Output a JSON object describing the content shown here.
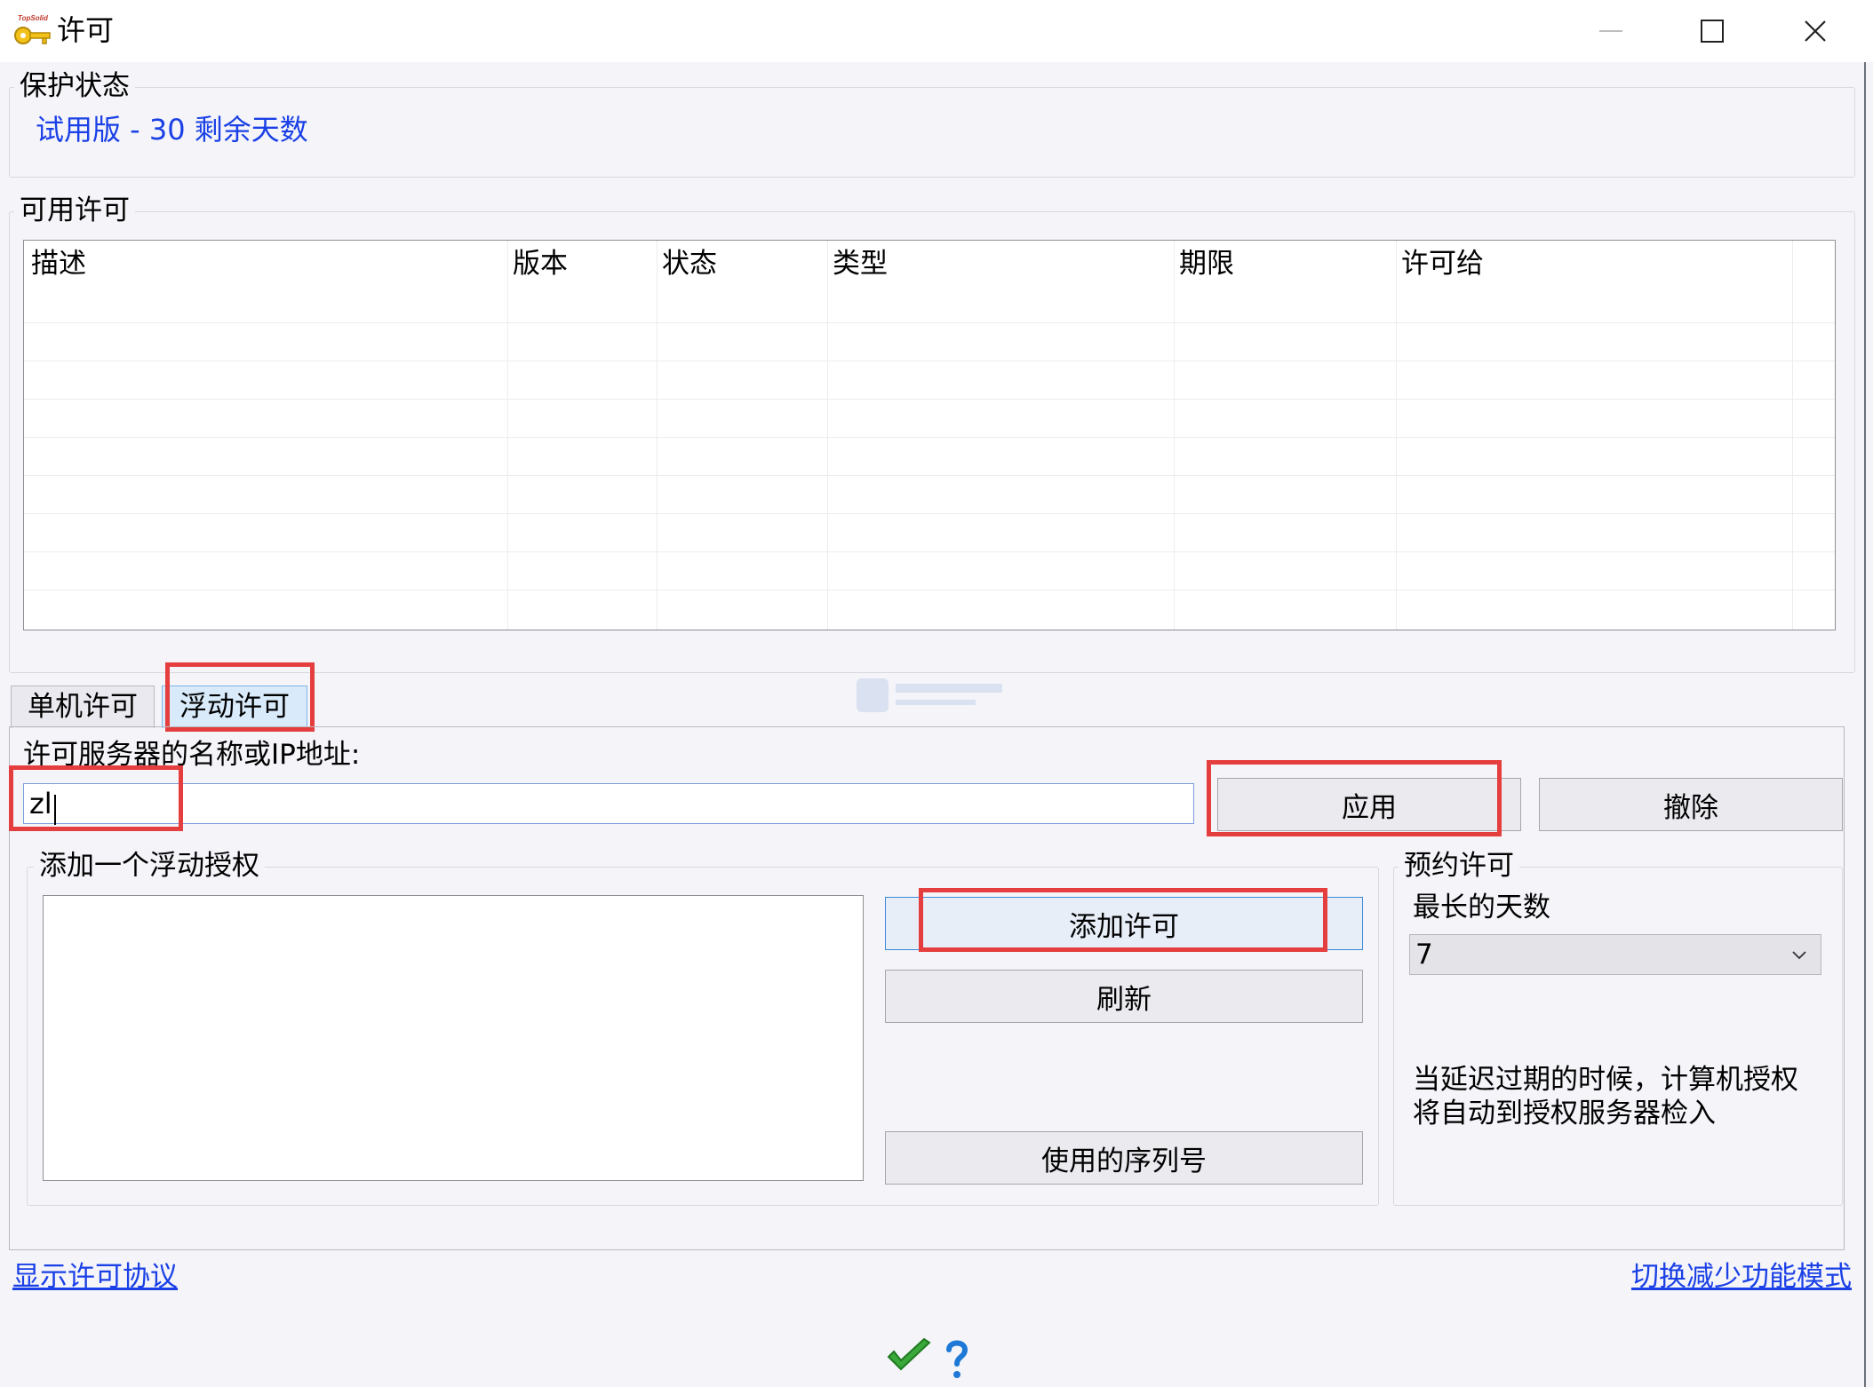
{
  "window": {
    "title": "许可",
    "icon_name": "topsolid-key-icon",
    "icon_caption": "TopSolid"
  },
  "protection_status": {
    "legend": "保护状态",
    "status_text": "试用版 - 30 剩余天数"
  },
  "available_licenses": {
    "legend": "可用许可",
    "columns": [
      "描述",
      "版本",
      "状态",
      "类型",
      "期限",
      "许可给"
    ],
    "rows": []
  },
  "tabs": [
    {
      "label": "单机许可",
      "active": false
    },
    {
      "label": "浮动许可",
      "active": true
    }
  ],
  "floating": {
    "server_label": "许可服务器的名称或IP地址:",
    "server_value": "zl",
    "apply_label": "应用",
    "cancel_label": "撤除",
    "add_group_legend": "添加一个浮动授权",
    "add_license_label": "添加许可",
    "refresh_label": "刷新",
    "serials_label": "使用的序列号",
    "reserve": {
      "legend": "预约许可",
      "max_days_label": "最长的天数",
      "max_days_value": "7",
      "note_line1": "当延迟过期的时候，计算机授权",
      "note_line2": "将自动到授权服务器检入"
    }
  },
  "footer": {
    "show_agreement_link": "显示许可协议",
    "reduced_mode_link": "切换减少功能模式"
  },
  "colors": {
    "accent_blue": "#1a40e6",
    "highlight_red": "#e53e3e",
    "ok_green": "#3aa83a",
    "help_blue": "#1e78d6"
  }
}
